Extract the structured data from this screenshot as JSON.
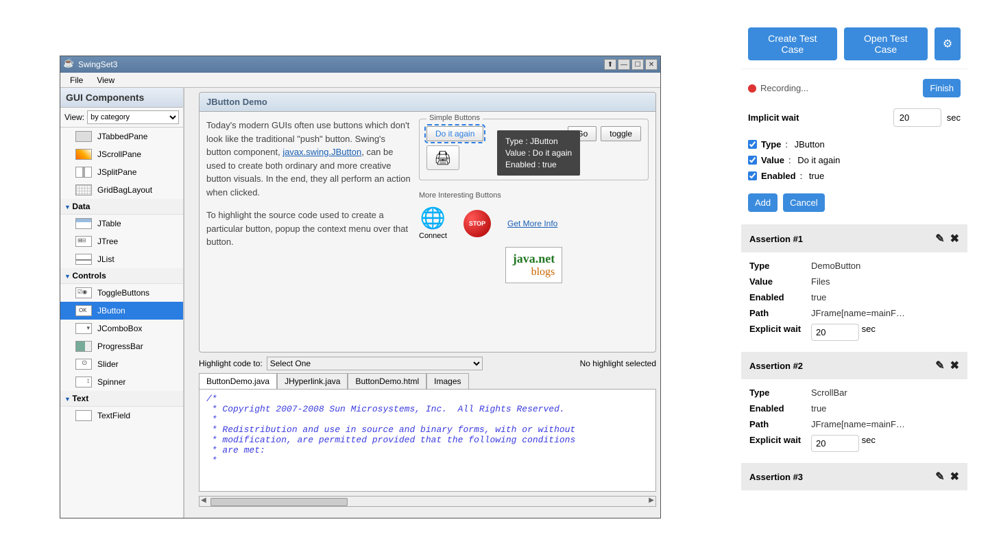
{
  "swing": {
    "title": "SwingSet3",
    "menus": [
      "File",
      "View"
    ],
    "sidebar_title": "GUI Components",
    "view_label": "View:",
    "view_select": "by category",
    "categories": {
      "containers": {
        "items": [
          "JTabbedPane",
          "JScrollPane",
          "JSplitPane",
          "GridBagLayout"
        ]
      },
      "data": {
        "label": "Data",
        "items": [
          "JTable",
          "JTree",
          "JList"
        ]
      },
      "controls": {
        "label": "Controls",
        "items": [
          "ToggleButtons",
          "JButton",
          "JComboBox",
          "ProgressBar",
          "Slider",
          "Spinner"
        ]
      },
      "text": {
        "label": "Text",
        "items": [
          "TextField"
        ]
      }
    },
    "demo": {
      "title": "JButton Demo",
      "para1": "Today's modern GUIs often use buttons which don't look like the traditional \"push\" button. Swing's button component, ",
      "link": "javax.swing.JButton",
      "para1b": ", can be used to create both ordinary and more creative button visuals. In the end, they all perform an action when clicked.",
      "para2": "To highlight the source code used to create a particular button, popup the context menu over that button.",
      "simple_label": "Simple Buttons",
      "simple_buttons": {
        "doit": "Do it again",
        "go": "Go",
        "toggle": "toggle"
      },
      "interest_label": "More Interesting Buttons",
      "connect_label": "Connect",
      "stop_label": "STOP",
      "moreinfo": "Get More Info",
      "javanet_top": "java.net",
      "javanet_bot": "blogs"
    },
    "tooltip": {
      "type": "Type : JButton",
      "value": "Value : Do it again",
      "enabled": "Enabled : true"
    },
    "highlight_label": "Highlight code to:",
    "highlight_select": "Select One",
    "highlight_status": "No highlight selected",
    "code_tabs": [
      "ButtonDemo.java",
      "JHyperlink.java",
      "ButtonDemo.html",
      "Images"
    ],
    "code": "/*\n * Copyright 2007-2008 Sun Microsystems, Inc.  All Rights Reserved.\n *\n * Redistribution and use in source and binary forms, with or without\n * modification, are permitted provided that the following conditions\n * are met:\n *"
  },
  "panel": {
    "create": "Create Test Case",
    "open": "Open Test Case",
    "recording": "Recording...",
    "finish": "Finish",
    "implicit_label": "Implicit wait",
    "implicit_value": "20",
    "sec": "sec",
    "checks": [
      {
        "key": "Type",
        "val": "JButton"
      },
      {
        "key": "Value",
        "val": "Do it again"
      },
      {
        "key": "Enabled",
        "val": "true"
      }
    ],
    "add": "Add",
    "cancel": "Cancel",
    "assertions": [
      {
        "title": "Assertion #1",
        "rows": [
          {
            "k": "Type",
            "v": "DemoButton"
          },
          {
            "k": "Value",
            "v": "Files"
          },
          {
            "k": "Enabled",
            "v": "true"
          },
          {
            "k": "Path",
            "v": "JFrame[name=mainF…"
          }
        ],
        "explicit_label": "Explicit wait",
        "explicit_value": "20"
      },
      {
        "title": "Assertion #2",
        "rows": [
          {
            "k": "Type",
            "v": "ScrollBar"
          },
          {
            "k": "Enabled",
            "v": "true"
          },
          {
            "k": "Path",
            "v": "JFrame[name=mainF…"
          }
        ],
        "explicit_label": "Explicit wait",
        "explicit_value": "20"
      },
      {
        "title": "Assertion #3"
      }
    ]
  }
}
